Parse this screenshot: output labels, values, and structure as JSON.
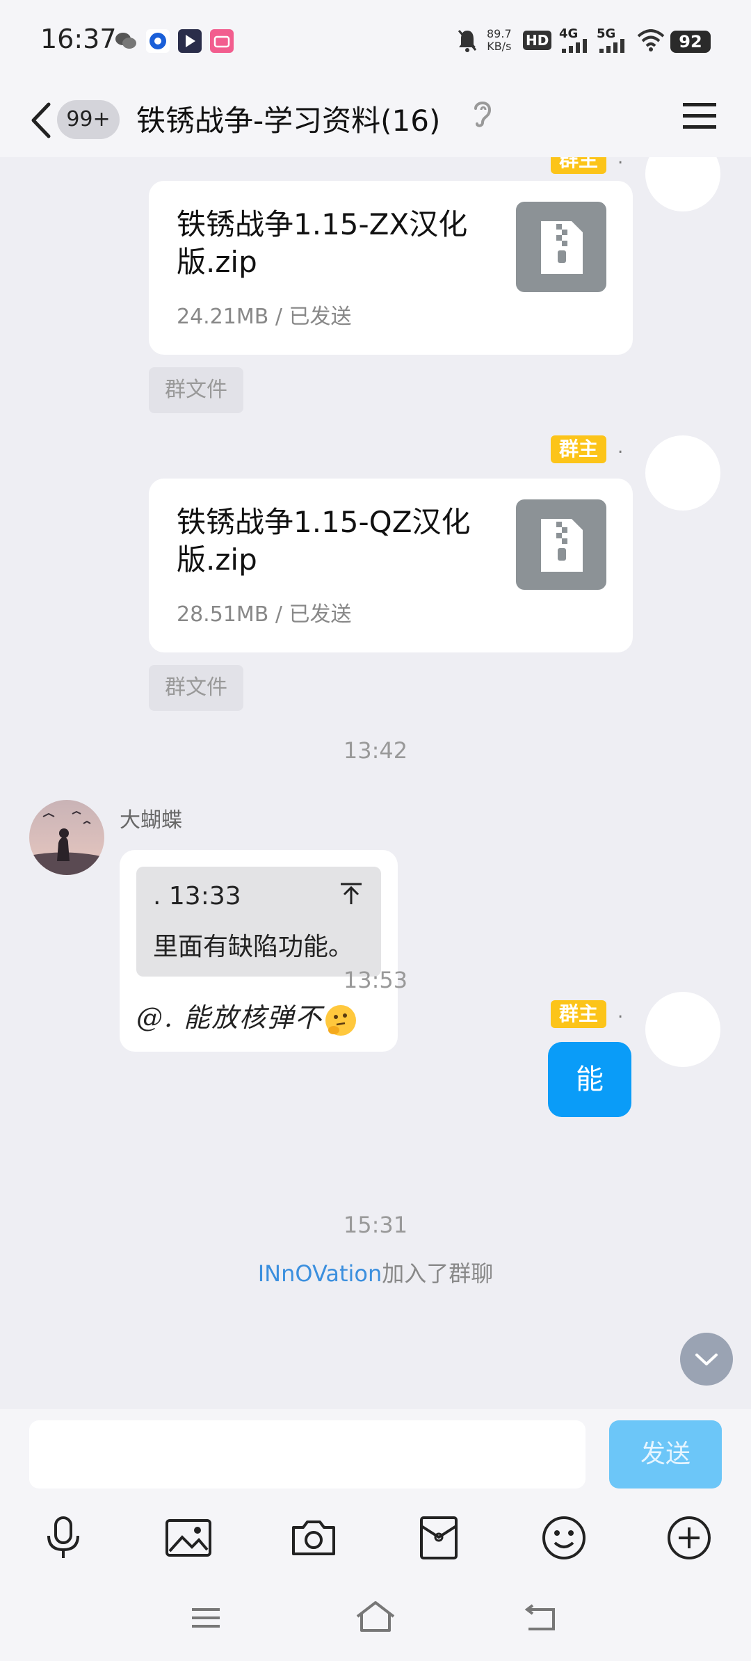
{
  "status_bar": {
    "time": "16:37",
    "net_speed_value": "89.7",
    "net_speed_unit": "KB/s",
    "hd": "HD",
    "net_4g": "4G",
    "net_5g": "5G",
    "battery": "92"
  },
  "header": {
    "unread_badge": "99+",
    "title": "铁锈战争-学习资料(16)"
  },
  "messages": {
    "file1": {
      "name": "铁锈战争1.15-ZX汉化版.zip",
      "meta": "24.21MB / 已发送",
      "tag": "群文件"
    },
    "owner_tag": "群主",
    "dot": ".",
    "file2": {
      "name": "铁锈战争1.15-QZ汉化版.zip",
      "meta": "28.51MB / 已发送",
      "tag": "群文件"
    },
    "time1": "13:42",
    "sender": "大蝴蝶",
    "quote_head": ". 13:33",
    "quote_text": "里面有缺陷功能。",
    "reply_text": "@. 能放核弹不",
    "time2": "13:53",
    "my_reply": "能",
    "time3": "15:31",
    "join_name": "INnOVation",
    "join_suffix": "加入了群聊"
  },
  "input": {
    "placeholder": "",
    "send_label": "发送"
  },
  "icons": {
    "toolbar": [
      "microphone-icon",
      "image-icon",
      "camera-icon",
      "red-packet-icon",
      "emoji-icon",
      "plus-icon"
    ],
    "nav": [
      "menu-icon",
      "home-icon",
      "back-icon"
    ]
  },
  "colors": {
    "accent_blue": "#0a9cf8",
    "owner_tag": "#fcc419",
    "link_blue": "#3b8fde"
  }
}
